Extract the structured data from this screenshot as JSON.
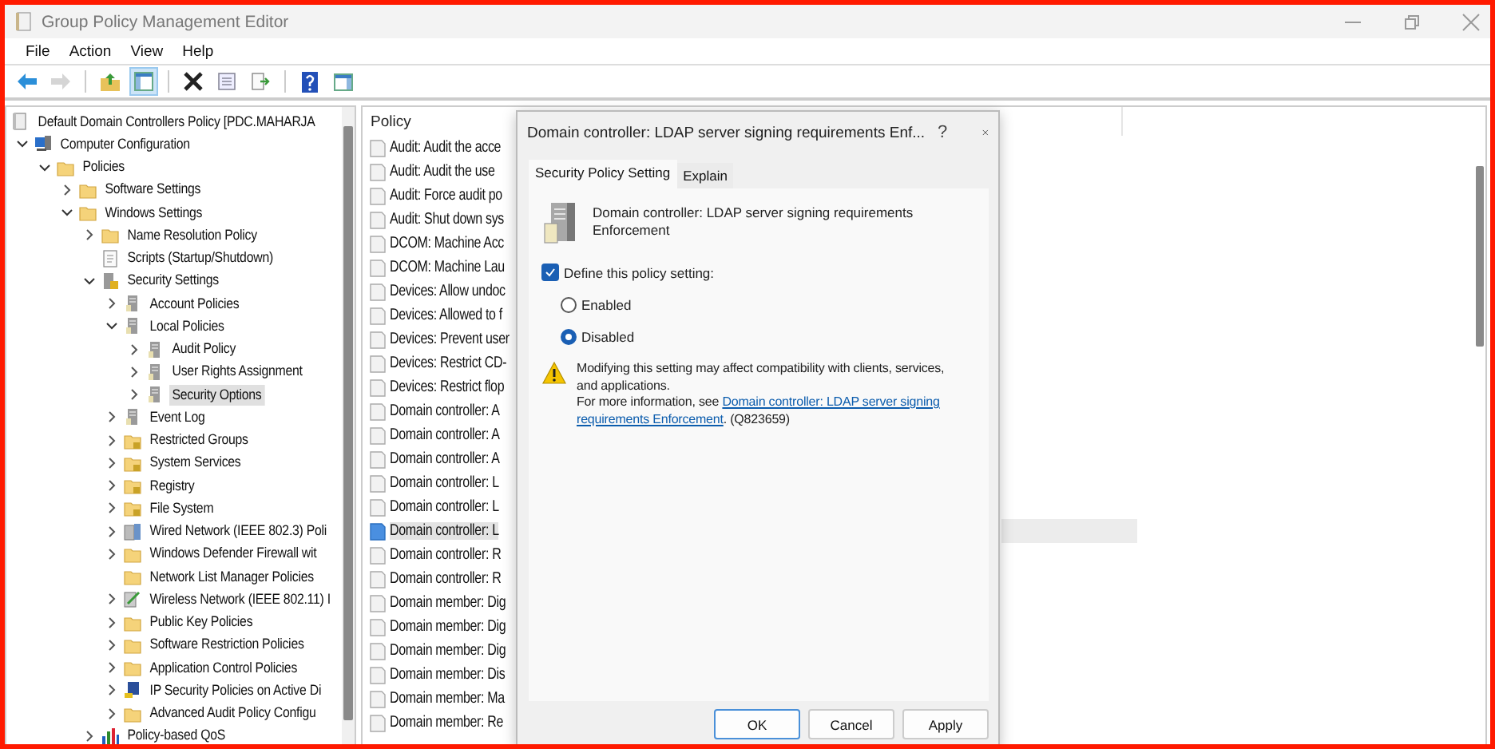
{
  "window": {
    "title": "Group Policy Management Editor"
  },
  "menu": [
    "File",
    "Action",
    "View",
    "Help"
  ],
  "toolbar": [
    {
      "kind": "back",
      "disabled": false
    },
    {
      "kind": "forward",
      "disabled": true
    },
    {
      "kind": "separator"
    },
    {
      "kind": "up",
      "disabled": false
    },
    {
      "kind": "tree",
      "disabled": false,
      "pressed": true
    },
    {
      "kind": "separator"
    },
    {
      "kind": "delete",
      "disabled": false
    },
    {
      "kind": "properties",
      "disabled": false
    },
    {
      "kind": "export",
      "disabled": false
    },
    {
      "kind": "separator"
    },
    {
      "kind": "help",
      "disabled": false
    },
    {
      "kind": "pane",
      "disabled": false
    }
  ],
  "tree": [
    {
      "label": "Default Domain Controllers Policy [PDC.MAHARJA",
      "kind": "policy",
      "selected": false,
      "children": [
        {
          "label": "Computer Configuration",
          "kind": "computer",
          "expanded": true,
          "selected": false,
          "children": [
            {
              "label": "Policies",
              "kind": "folder",
              "expanded": true,
              "selected": false,
              "children": [
                {
                  "label": "Software Settings",
                  "kind": "folder",
                  "expanded": false,
                  "selected": false
                },
                {
                  "label": "Windows Settings",
                  "kind": "folder",
                  "expanded": true,
                  "selected": false,
                  "children": [
                    {
                      "label": "Name Resolution Policy",
                      "kind": "folder",
                      "expanded": false,
                      "selected": false
                    },
                    {
                      "label": "Scripts (Startup/Shutdown)",
                      "kind": "script",
                      "selected": false
                    },
                    {
                      "label": "Security Settings",
                      "kind": "secure",
                      "expanded": true,
                      "selected": false,
                      "children": [
                        {
                          "label": "Account Policies",
                          "kind": "server",
                          "expanded": false,
                          "selected": false
                        },
                        {
                          "label": "Local Policies",
                          "kind": "server",
                          "expanded": true,
                          "selected": false,
                          "children": [
                            {
                              "label": "Audit Policy",
                              "kind": "server",
                              "expanded": false,
                              "selected": false
                            },
                            {
                              "label": "User Rights Assignment",
                              "kind": "server",
                              "expanded": false,
                              "selected": false
                            },
                            {
                              "label": "Security Options",
                              "kind": "server",
                              "expanded": false,
                              "selected": true
                            }
                          ]
                        },
                        {
                          "label": "Event Log",
                          "kind": "server",
                          "expanded": false,
                          "selected": false
                        },
                        {
                          "label": "Restricted Groups",
                          "kind": "locked",
                          "expanded": false,
                          "selected": false
                        },
                        {
                          "label": "System Services",
                          "kind": "locked",
                          "expanded": false,
                          "selected": false
                        },
                        {
                          "label": "Registry",
                          "kind": "locked",
                          "expanded": false,
                          "selected": false
                        },
                        {
                          "label": "File System",
                          "kind": "locked",
                          "expanded": false,
                          "selected": false
                        },
                        {
                          "label": "Wired Network (IEEE 802.3) Poli",
                          "kind": "network",
                          "expanded": false,
                          "selected": false
                        },
                        {
                          "label": "Windows Defender Firewall wit",
                          "kind": "folder",
                          "expanded": false,
                          "selected": false
                        },
                        {
                          "label": "Network List Manager Policies",
                          "kind": "folder",
                          "selected": false
                        },
                        {
                          "label": "Wireless Network (IEEE 802.11) I",
                          "kind": "wireless",
                          "expanded": false,
                          "selected": false
                        },
                        {
                          "label": "Public Key Policies",
                          "kind": "folder",
                          "expanded": false,
                          "selected": false
                        },
                        {
                          "label": "Software Restriction Policies",
                          "kind": "folder",
                          "expanded": false,
                          "selected": false
                        },
                        {
                          "label": "Application Control Policies",
                          "kind": "folder",
                          "expanded": false,
                          "selected": false
                        },
                        {
                          "label": "IP Security Policies on Active Di",
                          "kind": "ipsec",
                          "expanded": false,
                          "selected": false
                        },
                        {
                          "label": "Advanced Audit Policy Configu",
                          "kind": "folder",
                          "expanded": false,
                          "selected": false
                        }
                      ]
                    },
                    {
                      "label": "Policy-based QoS",
                      "kind": "chart",
                      "expanded": false,
                      "selected": false
                    }
                  ]
                }
              ]
            }
          ]
        }
      ]
    }
  ],
  "list": {
    "column": "Policy",
    "items": [
      {
        "label": "Audit: Audit the acce",
        "selected": false
      },
      {
        "label": "Audit: Audit the use",
        "selected": false
      },
      {
        "label": "Audit: Force audit po",
        "selected": false
      },
      {
        "label": "Audit: Shut down sys",
        "selected": false
      },
      {
        "label": "DCOM: Machine Acc",
        "selected": false
      },
      {
        "label": "DCOM: Machine Lau",
        "selected": false
      },
      {
        "label": "Devices: Allow undoc",
        "selected": false
      },
      {
        "label": "Devices: Allowed to f",
        "selected": false
      },
      {
        "label": "Devices: Prevent user",
        "selected": false
      },
      {
        "label": "Devices: Restrict CD-",
        "selected": false
      },
      {
        "label": "Devices: Restrict flop",
        "selected": false
      },
      {
        "label": "Domain controller: A",
        "selected": false
      },
      {
        "label": "Domain controller: A",
        "selected": false
      },
      {
        "label": "Domain controller: A",
        "selected": false
      },
      {
        "label": "Domain controller: L",
        "selected": false
      },
      {
        "label": "Domain controller: L",
        "selected": false
      },
      {
        "label": "Domain controller: L",
        "selected": true
      },
      {
        "label": "Domain controller: R",
        "selected": false
      },
      {
        "label": "Domain controller: R",
        "selected": false
      },
      {
        "label": "Domain member: Dig",
        "selected": false
      },
      {
        "label": "Domain member: Dig",
        "selected": false
      },
      {
        "label": "Domain member: Dig",
        "selected": false
      },
      {
        "label": "Domain member: Dis",
        "selected": false
      },
      {
        "label": "Domain member: Ma",
        "selected": false
      },
      {
        "label": "Domain member: Re",
        "selected": false
      }
    ]
  },
  "dialog": {
    "title": "Domain controller: LDAP server signing requirements Enf...",
    "help": "?",
    "tabs": [
      {
        "label": "Security Policy Setting",
        "selected": true
      },
      {
        "label": "Explain",
        "selected": false
      }
    ],
    "heading": "Domain controller: LDAP server signing requirements Enforcement",
    "define": {
      "label": "Define this policy setting:",
      "checked": true
    },
    "options": [
      {
        "label": "Enabled",
        "selected": false
      },
      {
        "label": "Disabled",
        "selected": true
      }
    ],
    "warning": "Modifying this setting may affect compatibility with clients, services, and applications.",
    "more_info": {
      "prefix": "For more information, see ",
      "link_lines": [
        "Domain controller: LDAP server signing",
        "requirements Enforcement"
      ],
      "suffix": ". (Q823659)"
    },
    "buttons": [
      {
        "label": "OK",
        "default": true
      },
      {
        "label": "Cancel",
        "default": false
      },
      {
        "label": "Apply",
        "default": false
      }
    ]
  }
}
